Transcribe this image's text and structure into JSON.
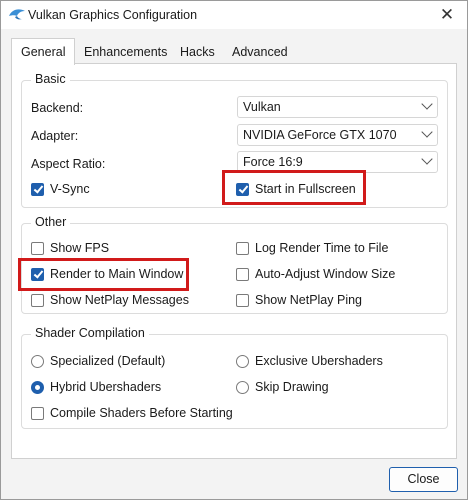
{
  "window": {
    "title": "Vulkan Graphics Configuration",
    "close_glyph": "✕"
  },
  "tabs": [
    {
      "label": "General",
      "active": true
    },
    {
      "label": "Enhancements",
      "active": false
    },
    {
      "label": "Hacks",
      "active": false
    },
    {
      "label": "Advanced",
      "active": false
    }
  ],
  "basic": {
    "title": "Basic",
    "backend": {
      "label": "Backend:",
      "value": "Vulkan"
    },
    "adapter": {
      "label": "Adapter:",
      "value": "NVIDIA GeForce GTX 1070"
    },
    "aspect": {
      "label": "Aspect Ratio:",
      "value": "Force 16:9"
    },
    "vsync": {
      "label": "V-Sync",
      "checked": true
    },
    "fullscreen": {
      "label": "Start in Fullscreen",
      "checked": true
    }
  },
  "other": {
    "title": "Other",
    "show_fps": {
      "label": "Show FPS",
      "checked": false
    },
    "log_render_time": {
      "label": "Log Render Time to File",
      "checked": false
    },
    "render_main_window": {
      "label": "Render to Main Window",
      "checked": true
    },
    "auto_adjust": {
      "label": "Auto-Adjust Window Size",
      "checked": false
    },
    "netplay_messages": {
      "label": "Show NetPlay Messages",
      "checked": false
    },
    "netplay_ping": {
      "label": "Show NetPlay Ping",
      "checked": false
    }
  },
  "shader": {
    "title": "Shader Compilation",
    "specialized": {
      "label": "Specialized (Default)",
      "selected": false
    },
    "exclusive": {
      "label": "Exclusive Ubershaders",
      "selected": false
    },
    "hybrid": {
      "label": "Hybrid Ubershaders",
      "selected": true
    },
    "skip": {
      "label": "Skip Drawing",
      "selected": false
    },
    "compile_before": {
      "label": "Compile Shaders Before Starting",
      "checked": false
    }
  },
  "buttons": {
    "close_label": "Close"
  },
  "colors": {
    "accent": "#1f5fad",
    "highlight": "#d11a1a"
  }
}
